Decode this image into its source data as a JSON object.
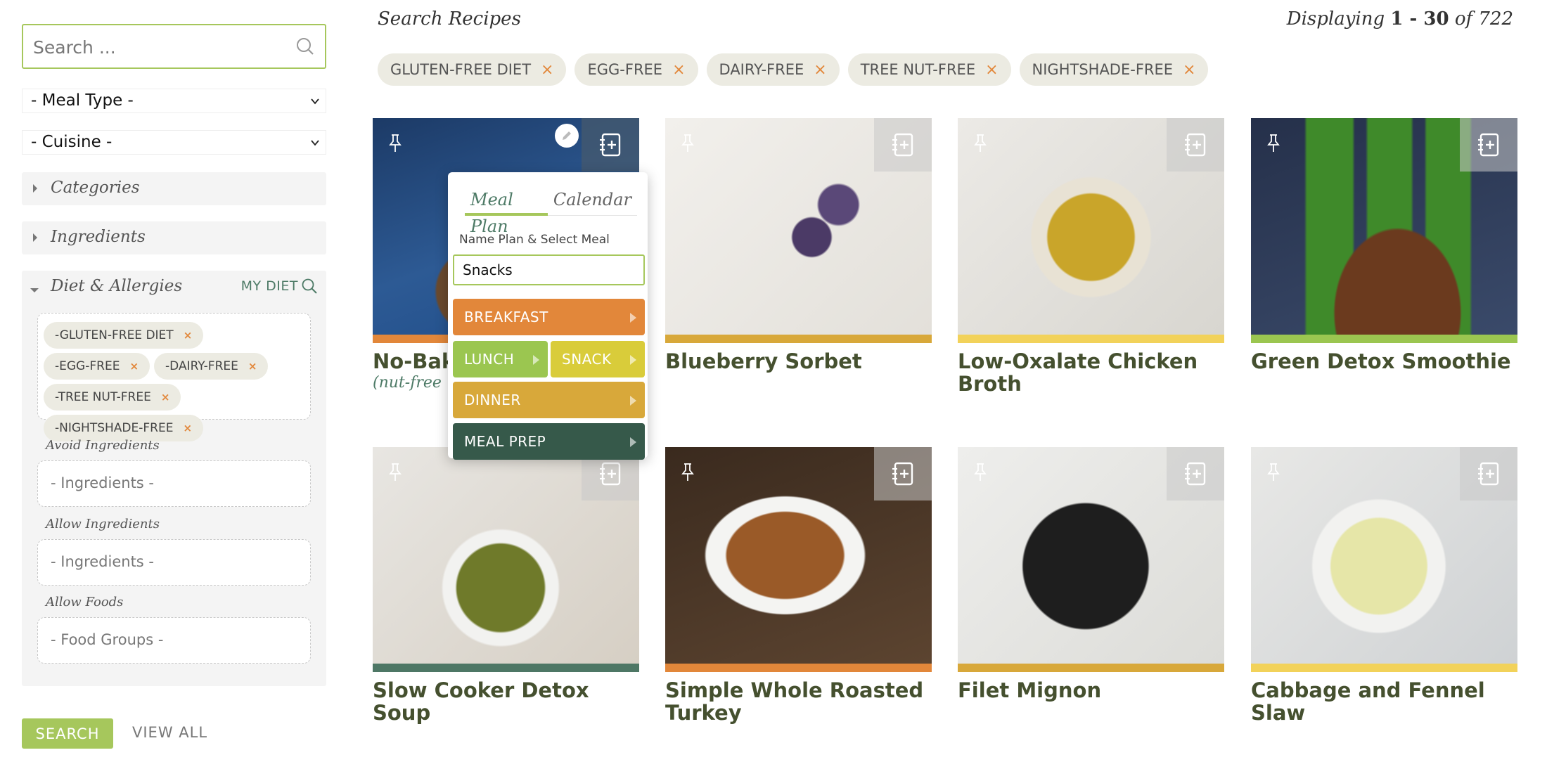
{
  "sidebar": {
    "search_placeholder": "Search ...",
    "meal_type": "- Meal Type -",
    "cuisine": "- Cuisine -",
    "categories_label": "Categories",
    "ingredients_label": "Ingredients",
    "diet_label": "Diet & Allergies",
    "my_diet_label": "MY DIET",
    "diet_chips": [
      "-GLUTEN-FREE DIET",
      "-EGG-FREE",
      "-DAIRY-FREE",
      "-TREE NUT-FREE",
      "-NIGHTSHADE-FREE"
    ],
    "avoid_label": "Avoid Ingredients",
    "avoid_placeholder": "- Ingredients -",
    "allow_label": "Allow Ingredients",
    "allow_placeholder": "- Ingredients -",
    "allow_foods_label": "Allow Foods",
    "allow_foods_placeholder": "- Food Groups -",
    "search_button": "SEARCH",
    "view_all": "VIEW ALL"
  },
  "main": {
    "title": "Search Recipes",
    "displaying_prefix": "Displaying",
    "displaying_range": "1 - 30",
    "displaying_of": "of 722",
    "filter_chips": [
      "GLUTEN-FREE DIET",
      "EGG-FREE",
      "DAIRY-FREE",
      "TREE NUT-FREE",
      "NIGHTSHADE-FREE"
    ],
    "remove_glyph": "×"
  },
  "colors": {
    "accent_green": "#a6c75c",
    "dark_green": "#4d7a66",
    "orange": "#e2873a",
    "mustard": "#d8a83a",
    "yellow": "#f2d25a",
    "lime": "#9bc650",
    "title_green": "#45502f"
  },
  "recipes": [
    {
      "title": "No-Bake",
      "subtitle": "(nut-free +",
      "strip": "#e2873a"
    },
    {
      "title": "Blueberry Sorbet",
      "strip": "#d8a83a"
    },
    {
      "title": "Low-Oxalate Chicken Broth",
      "strip": "#f2d25a"
    },
    {
      "title": "Green Detox Smoothie",
      "strip": "#9bc650"
    },
    {
      "title": "Slow Cooker Detox Soup",
      "strip": "#4e7765"
    },
    {
      "title": "Simple Whole Roasted Turkey",
      "strip": "#e2873a"
    },
    {
      "title": "Filet Mignon",
      "strip": "#d8a83a"
    },
    {
      "title": "Cabbage and Fennel Slaw",
      "strip": "#f2d25a"
    }
  ],
  "popup": {
    "tab_meal_plan": "Meal Plan",
    "tab_calendar": "Calendar",
    "label": "Name Plan & Select Meal",
    "plan_name": "Snacks",
    "meals": [
      {
        "label": "BREAKFAST",
        "color": "#e2873a"
      },
      {
        "label": "LUNCH",
        "color": "#9bc650"
      },
      {
        "label": "SNACK",
        "color": "#d9cc3a"
      },
      {
        "label": "DINNER",
        "color": "#d8a83a"
      },
      {
        "label": "MEAL PREP",
        "color": "#36594a"
      }
    ]
  }
}
